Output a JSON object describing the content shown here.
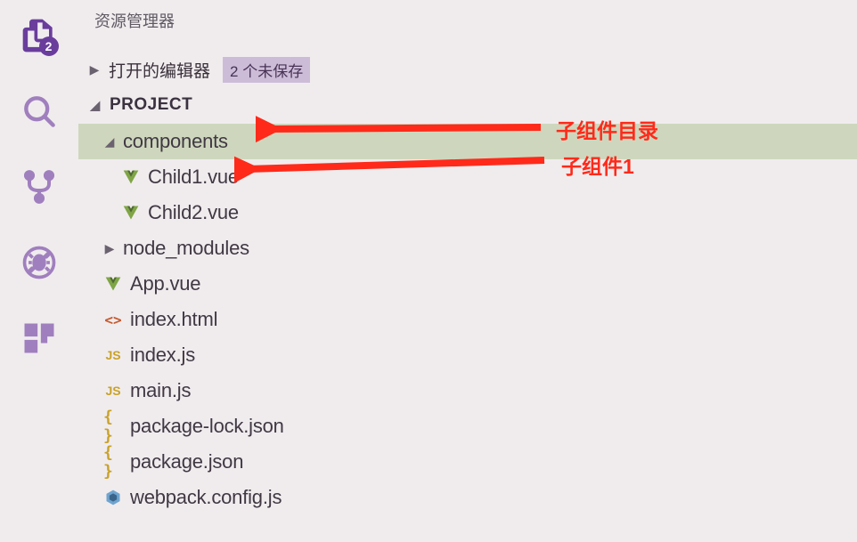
{
  "panel": {
    "title": "资源管理器",
    "open_editors_label": "打开的编辑器",
    "unsaved_badge": "2 个未保存"
  },
  "project": {
    "name": "PROJECT"
  },
  "tree": {
    "components": {
      "label": "components"
    },
    "child1": {
      "label": "Child1.vue"
    },
    "child2": {
      "label": "Child2.vue"
    },
    "node_modules": {
      "label": "node_modules"
    },
    "app_vue": {
      "label": "App.vue"
    },
    "index_html": {
      "label": "index.html"
    },
    "index_js": {
      "label": "index.js"
    },
    "main_js": {
      "label": "main.js"
    },
    "pkg_lock": {
      "label": "package-lock.json"
    },
    "pkg": {
      "label": "package.json"
    },
    "webpack": {
      "label": "webpack.config.js"
    }
  },
  "activity": {
    "explorer_badge": "2"
  },
  "annotations": {
    "label1": "子组件目录",
    "label2": "子组件1"
  }
}
